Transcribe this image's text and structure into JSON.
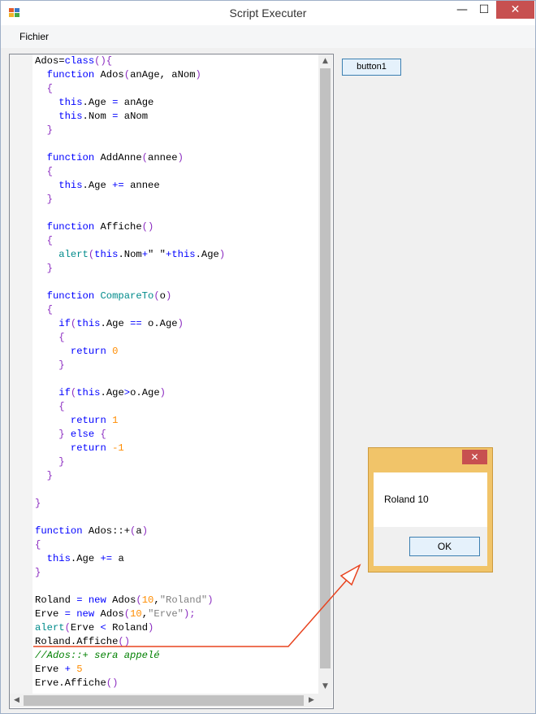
{
  "window": {
    "title": "Script Executer",
    "minimize": "—",
    "maximize": "☐",
    "close": "✕"
  },
  "menu": {
    "file": "Fichier"
  },
  "toolbar": {
    "button1_label": "button1"
  },
  "editor": {
    "lines": [
      [
        [
          "Ados=",
          "t"
        ],
        [
          "class",
          "kw"
        ],
        [
          "(){",
          "br"
        ]
      ],
      [
        [
          "  ",
          "t"
        ],
        [
          "function",
          "kw"
        ],
        [
          " Ados",
          "t"
        ],
        [
          "(",
          "br"
        ],
        [
          "anAge, aNom",
          "t"
        ],
        [
          ")",
          "br"
        ]
      ],
      [
        [
          "  ",
          "t"
        ],
        [
          "{",
          "br"
        ]
      ],
      [
        [
          "    ",
          "t"
        ],
        [
          "this",
          "kw"
        ],
        [
          ".Age ",
          "t"
        ],
        [
          "=",
          "kw"
        ],
        [
          " anAge",
          "t"
        ]
      ],
      [
        [
          "    ",
          "t"
        ],
        [
          "this",
          "kw"
        ],
        [
          ".Nom ",
          "t"
        ],
        [
          "=",
          "kw"
        ],
        [
          " aNom",
          "t"
        ]
      ],
      [
        [
          "  ",
          "t"
        ],
        [
          "}",
          "br"
        ]
      ],
      [],
      [
        [
          "  ",
          "t"
        ],
        [
          "function",
          "kw"
        ],
        [
          " AddAnne",
          "t"
        ],
        [
          "(",
          "br"
        ],
        [
          "annee",
          "t"
        ],
        [
          ")",
          "br"
        ]
      ],
      [
        [
          "  ",
          "t"
        ],
        [
          "{",
          "br"
        ]
      ],
      [
        [
          "    ",
          "t"
        ],
        [
          "this",
          "kw"
        ],
        [
          ".Age ",
          "t"
        ],
        [
          "+=",
          "kw"
        ],
        [
          " annee",
          "t"
        ]
      ],
      [
        [
          "  ",
          "t"
        ],
        [
          "}",
          "br"
        ]
      ],
      [],
      [
        [
          "  ",
          "t"
        ],
        [
          "function",
          "kw"
        ],
        [
          " Affiche",
          "t"
        ],
        [
          "()",
          "br"
        ]
      ],
      [
        [
          "  ",
          "t"
        ],
        [
          "{",
          "br"
        ]
      ],
      [
        [
          "    ",
          "t"
        ],
        [
          "alert",
          "fn"
        ],
        [
          "(",
          "br"
        ],
        [
          "this",
          "kw"
        ],
        [
          ".Nom",
          "t"
        ],
        [
          "+",
          "kw"
        ],
        [
          "\" \"",
          "t"
        ],
        [
          "+",
          "kw"
        ],
        [
          "this",
          "kw"
        ],
        [
          ".Age",
          "t"
        ],
        [
          ")",
          "br"
        ]
      ],
      [
        [
          "  ",
          "t"
        ],
        [
          "}",
          "br"
        ]
      ],
      [],
      [
        [
          "  ",
          "t"
        ],
        [
          "function",
          "kw"
        ],
        [
          " ",
          "t"
        ],
        [
          "CompareTo",
          "fn"
        ],
        [
          "(",
          "br"
        ],
        [
          "o",
          "t"
        ],
        [
          ")",
          "br"
        ]
      ],
      [
        [
          "  ",
          "t"
        ],
        [
          "{",
          "br"
        ]
      ],
      [
        [
          "    ",
          "t"
        ],
        [
          "if",
          "kw"
        ],
        [
          "(",
          "br"
        ],
        [
          "this",
          "kw"
        ],
        [
          ".Age ",
          "t"
        ],
        [
          "==",
          "kw"
        ],
        [
          " o.Age",
          "t"
        ],
        [
          ")",
          "br"
        ]
      ],
      [
        [
          "    ",
          "t"
        ],
        [
          "{",
          "br"
        ]
      ],
      [
        [
          "      ",
          "t"
        ],
        [
          "return",
          "kw"
        ],
        [
          " ",
          "t"
        ],
        [
          "0",
          "num"
        ]
      ],
      [
        [
          "    ",
          "t"
        ],
        [
          "}",
          "br"
        ]
      ],
      [],
      [
        [
          "    ",
          "t"
        ],
        [
          "if",
          "kw"
        ],
        [
          "(",
          "br"
        ],
        [
          "this",
          "kw"
        ],
        [
          ".Age",
          "t"
        ],
        [
          ">",
          "kw"
        ],
        [
          "o.Age",
          "t"
        ],
        [
          ")",
          "br"
        ]
      ],
      [
        [
          "    ",
          "t"
        ],
        [
          "{",
          "br"
        ]
      ],
      [
        [
          "      ",
          "t"
        ],
        [
          "return",
          "kw"
        ],
        [
          " ",
          "t"
        ],
        [
          "1",
          "num"
        ]
      ],
      [
        [
          "    ",
          "t"
        ],
        [
          "}",
          "br"
        ],
        [
          " else",
          "kw"
        ],
        [
          " ",
          "t"
        ],
        [
          "{",
          "br"
        ]
      ],
      [
        [
          "      ",
          "t"
        ],
        [
          "return",
          "kw"
        ],
        [
          " ",
          "t"
        ],
        [
          "-1",
          "num"
        ]
      ],
      [
        [
          "    ",
          "t"
        ],
        [
          "}",
          "br"
        ]
      ],
      [
        [
          "  ",
          "t"
        ],
        [
          "}",
          "br"
        ]
      ],
      [],
      [
        [
          "}",
          "br"
        ]
      ],
      [],
      [
        [
          "function",
          "kw"
        ],
        [
          " Ados::+",
          "t"
        ],
        [
          "(",
          "br"
        ],
        [
          "a",
          "t"
        ],
        [
          ")",
          "br"
        ]
      ],
      [
        [
          "{",
          "br"
        ]
      ],
      [
        [
          "  ",
          "t"
        ],
        [
          "this",
          "kw"
        ],
        [
          ".Age ",
          "t"
        ],
        [
          "+=",
          "kw"
        ],
        [
          " a",
          "t"
        ]
      ],
      [
        [
          "}",
          "br"
        ]
      ],
      [],
      [
        [
          "Roland ",
          "t"
        ],
        [
          "=",
          "kw"
        ],
        [
          " ",
          "t"
        ],
        [
          "new",
          "kw"
        ],
        [
          " Ados",
          "t"
        ],
        [
          "(",
          "br"
        ],
        [
          "10",
          "num"
        ],
        [
          ",",
          "t"
        ],
        [
          "\"Roland\"",
          "str"
        ],
        [
          ")",
          "br"
        ]
      ],
      [
        [
          "Erve ",
          "t"
        ],
        [
          "=",
          "kw"
        ],
        [
          " ",
          "t"
        ],
        [
          "new",
          "kw"
        ],
        [
          " Ados",
          "t"
        ],
        [
          "(",
          "br"
        ],
        [
          "10",
          "num"
        ],
        [
          ",",
          "t"
        ],
        [
          "\"Erve\"",
          "str"
        ],
        [
          ");",
          "br"
        ]
      ],
      [
        [
          "alert",
          "fn"
        ],
        [
          "(",
          "br"
        ],
        [
          "Erve ",
          "t"
        ],
        [
          "<",
          "kw"
        ],
        [
          " Roland",
          "t"
        ],
        [
          ")",
          "br"
        ]
      ],
      [
        [
          "Roland.Affiche",
          "t"
        ],
        [
          "()",
          "br"
        ]
      ],
      [
        [
          "//Ados::+ sera appelé",
          "cmt"
        ]
      ],
      [
        [
          "Erve ",
          "t"
        ],
        [
          "+",
          "kw"
        ],
        [
          " ",
          "t"
        ],
        [
          "5",
          "num"
        ]
      ],
      [
        [
          "Erve.Affiche",
          "t"
        ],
        [
          "()",
          "br"
        ]
      ]
    ]
  },
  "dialog": {
    "message": "Roland 10",
    "ok_label": "OK",
    "close": "✕"
  },
  "colors": {
    "keyword": "#0000ff",
    "bracket": "#8c2dc1",
    "number": "#ff8c00",
    "string": "#808080",
    "function": "#008b8b",
    "comment": "#008000",
    "annotation_arrow": "#e8431f"
  }
}
